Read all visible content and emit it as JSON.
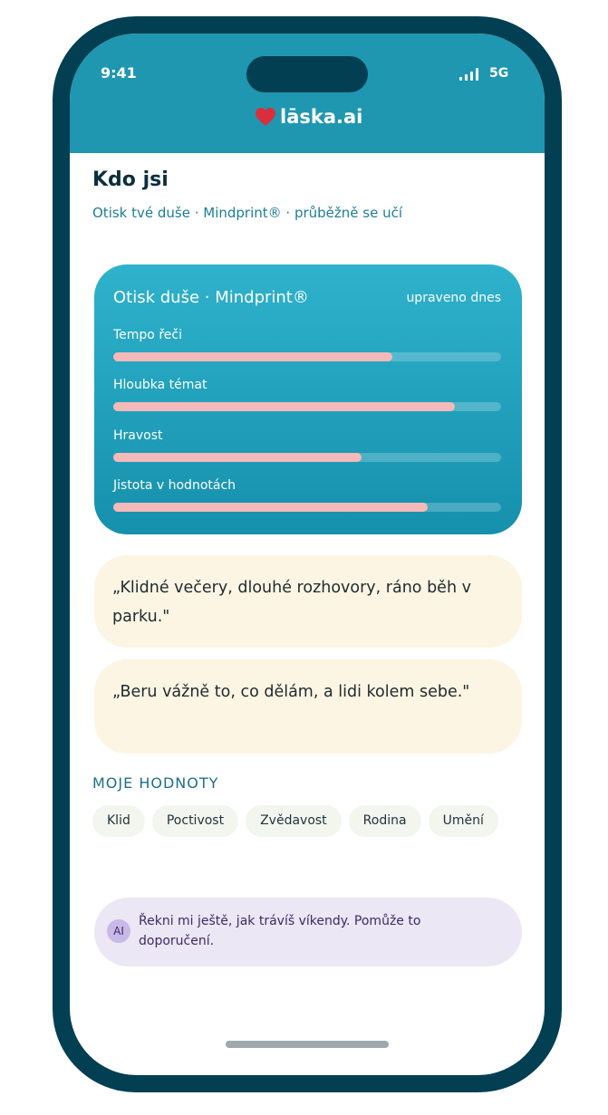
{
  "status_bar": {
    "time": "9:41",
    "network": "5G",
    "signal_icon": "signal-bars-icon"
  },
  "header": {
    "logo_icon": "heart-icon",
    "brand": "lāska.ai"
  },
  "page": {
    "title": "Kdo jsi",
    "subtitle": "Otisk tvé duše · Mindprint® · průběžně se učí"
  },
  "mindprint": {
    "title": "Otisk duše · Mindprint®",
    "updated": "upraveno dnes",
    "metrics": [
      {
        "label": "Tempo řeči",
        "value": 0.72
      },
      {
        "label": "Hloubka témat",
        "value": 0.88
      },
      {
        "label": "Hravost",
        "value": 0.64
      },
      {
        "label": "Jistota v hodnotách",
        "value": 0.81
      }
    ]
  },
  "quotes": [
    "„Klidné večery, dlouhé rozhovory, ráno běh v parku.\"",
    "„Beru vážně to, co dělám, a lidi kolem sebe.\""
  ],
  "values": {
    "heading": "MOJE HODNOTY",
    "chips": [
      "Klid",
      "Poctivost",
      "Zvědavost",
      "Rodina",
      "Umění"
    ]
  },
  "ai_prompt": {
    "badge": "AI",
    "text": "Řekni mi ještě, jak trávíš víkendy. Pomůže to doporučení."
  },
  "colors": {
    "accent": "#1f97b1",
    "frame": "#023f52",
    "bar_fill": "#f4b9b8",
    "quote_bg": "#fdf5e3",
    "ai_bg": "#ebe7f4"
  }
}
